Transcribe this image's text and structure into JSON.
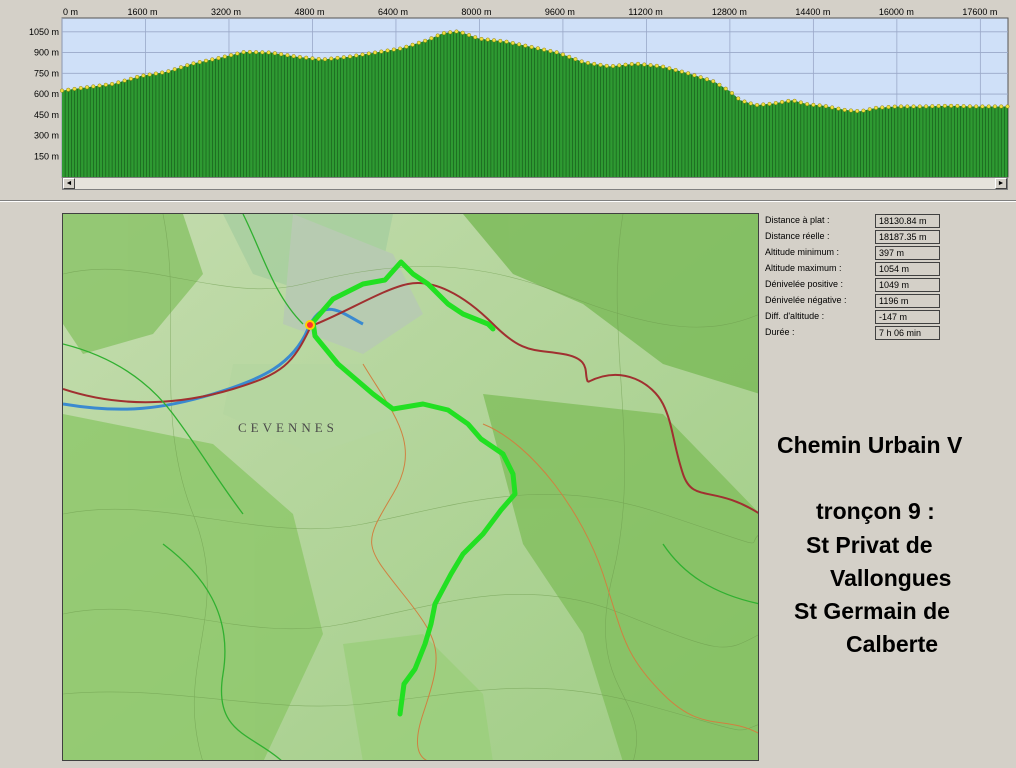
{
  "profile": {
    "x_ticks": [
      "0 m",
      "1600 m",
      "3200 m",
      "4800 m",
      "6400 m",
      "8000 m",
      "9600 m",
      "11200 m",
      "12800 m",
      "14400 m",
      "16000 m",
      "17600 m"
    ],
    "y_ticks": [
      "1050 m",
      "900 m",
      "750 m",
      "600 m",
      "450 m",
      "300 m",
      "150 m"
    ],
    "colors": {
      "sky": "#cfe0f8",
      "terrain": "#2e9a32",
      "grid": "#9aa8c8",
      "marker": "#f0e040"
    }
  },
  "chart_data": {
    "type": "area",
    "title": "",
    "xlabel": "",
    "ylabel": "",
    "xlim": [
      0,
      18130
    ],
    "ylim": [
      0,
      1150
    ],
    "grid": true,
    "x": [
      0,
      500,
      1000,
      1500,
      2000,
      2500,
      3000,
      3500,
      4000,
      4500,
      5000,
      5500,
      6000,
      6500,
      7000,
      7300,
      7600,
      8000,
      8500,
      9000,
      9500,
      10000,
      10500,
      11000,
      11500,
      12000,
      12500,
      12800,
      13000,
      13300,
      13600,
      14000,
      14300,
      14600,
      15000,
      15300,
      15600,
      16000,
      16500,
      17000,
      17500,
      18130
    ],
    "series": [
      {
        "values": [
          625,
          650,
          675,
          730,
          760,
          820,
          860,
          905,
          900,
          870,
          850,
          870,
          900,
          930,
          990,
          1040,
          1054,
          1000,
          980,
          940,
          900,
          830,
          800,
          820,
          800,
          750,
          690,
          620,
          555,
          520,
          530,
          555,
          525,
          515,
          485,
          475,
          500,
          510,
          510,
          515,
          510,
          510
        ]
      }
    ]
  },
  "scrollbar": {
    "left_arrow": "◄",
    "right_arrow": "►"
  },
  "stats": [
    {
      "label": "Distance à plat :",
      "value": "18130.84 m"
    },
    {
      "label": "Distance réelle :",
      "value": "18187.35 m"
    },
    {
      "label": "Altitude minimum :",
      "value": "397 m"
    },
    {
      "label": "Altitude maximum :",
      "value": "1054 m"
    },
    {
      "label": "Dénivelée positive :",
      "value": "1049 m"
    },
    {
      "label": "Dénivelée négative :",
      "value": "1196 m"
    },
    {
      "label": "Diff. d'altitude :",
      "value": "-147 m"
    },
    {
      "label": "Durée :",
      "value": "7 h 06 min"
    }
  ],
  "title": {
    "line1": "Chemin Urbain V",
    "line2": "tronçon 9 :",
    "line3": "St Privat de",
    "line4": "Vallongues",
    "line5": "St Germain de",
    "line6": "Calberte"
  },
  "map": {
    "label": "CEVENNES",
    "colors": {
      "base": "#b9d9a0",
      "forest": "#7fbf5a",
      "route": "#22e022",
      "road": "#a03030",
      "river": "#3a8ad0"
    }
  }
}
